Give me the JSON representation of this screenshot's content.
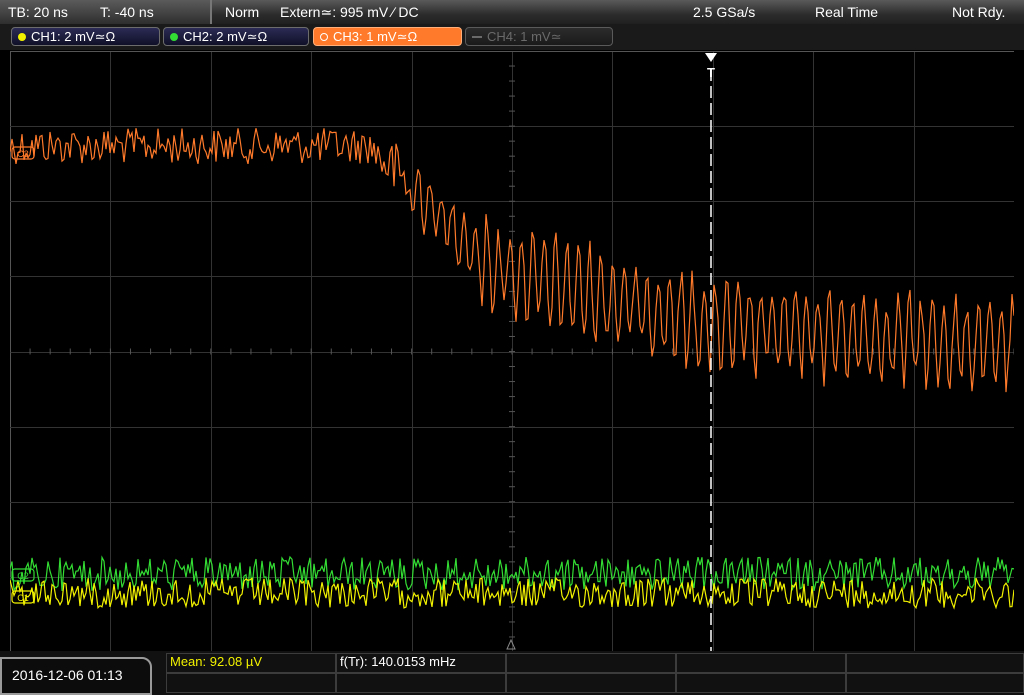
{
  "top": {
    "timebase": "TB: 20 ns",
    "trig_time": "T: -40 ns",
    "mode": "Norm",
    "trigger": "Extern≃: 995 mV ∕ DC",
    "sample_rate": "2.5 GSa/s",
    "acq_mode": "Real Time",
    "status": "Not Rdy."
  },
  "channels": [
    {
      "label": "CH1: 2 mV≃Ω",
      "color": "#f2f200",
      "active": false
    },
    {
      "label": "CH2: 2 mV≃Ω",
      "color": "#33dd33",
      "active": false
    },
    {
      "label": "CH3: 1 mV≃Ω",
      "color": "#ff7a2a",
      "active": true
    },
    {
      "label": "CH4: 1 mV≃",
      "color": "#6a6a6a",
      "active": false
    }
  ],
  "markers": {
    "ch3": "C3",
    "ch2": "C2",
    "ch1": "C1",
    "trigger": "T"
  },
  "bottom": {
    "datetime": "2016-12-06 01:13",
    "mean": "Mean: 92.08 µV",
    "freq": "f(Tr): 140.0153 mHz"
  },
  "colors": {
    "ch1": "#f2f200",
    "ch2": "#33dd33",
    "ch3": "#ff7a2a",
    "grid": "#3a3a3a",
    "active_tab": "#ff7a2a"
  }
}
